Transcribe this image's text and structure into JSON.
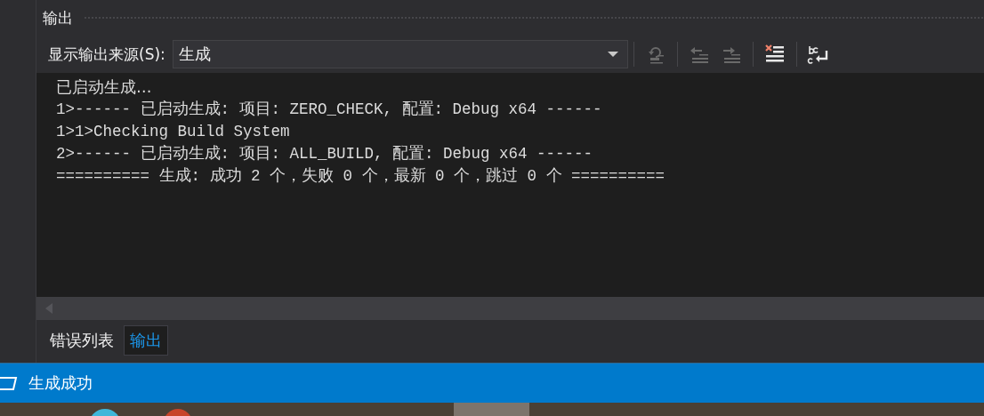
{
  "panel": {
    "title": "输出"
  },
  "toolbar": {
    "source_label": "显示输出来源(S):",
    "source_value": "生成",
    "buttons": [
      {
        "kind": "goto",
        "disabled": true
      },
      {
        "kind": "prev",
        "disabled": true
      },
      {
        "kind": "next",
        "disabled": true
      },
      {
        "kind": "clear",
        "disabled": false
      },
      {
        "kind": "wrap",
        "disabled": false
      }
    ]
  },
  "output_lines": [
    "已启动生成…",
    "1>------ 已启动生成: 项目: ZERO_CHECK, 配置: Debug x64 ------",
    "1>1>Checking Build System",
    "2>------ 已启动生成: 项目: ALL_BUILD, 配置: Debug x64 ------",
    "========== 生成: 成功 2 个，失败 0 个，最新 0 个，跳过 0 个 =========="
  ],
  "tabs": [
    {
      "label": "错误列表",
      "selected": false
    },
    {
      "label": "输出",
      "selected": true
    }
  ],
  "status_bar": {
    "text": "生成成功"
  }
}
